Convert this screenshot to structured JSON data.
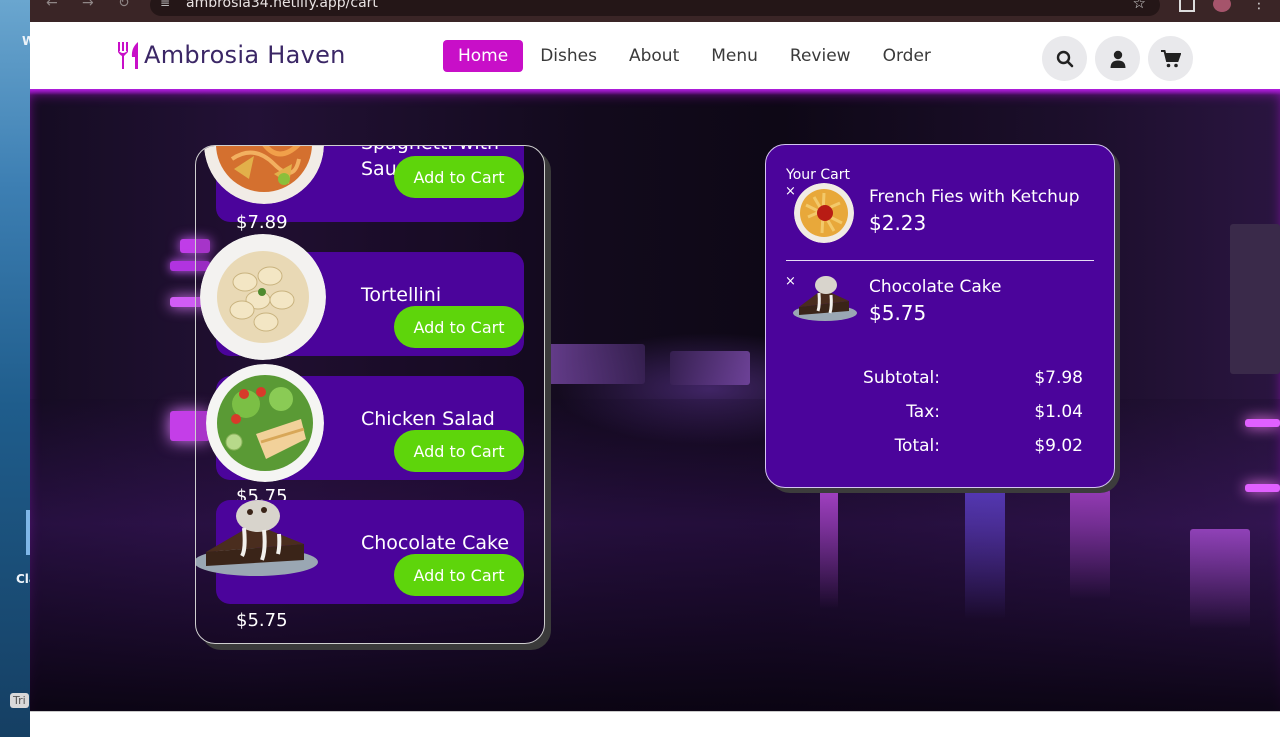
{
  "desktop": {
    "label_top": "W",
    "label_mid": "Cla",
    "badge": "Tri"
  },
  "browser": {
    "url": "ambrosia34.netlify.app/cart"
  },
  "site": {
    "logo_text": "Ambrosia Haven",
    "nav": [
      {
        "label": "Home",
        "active": true
      },
      {
        "label": "Dishes"
      },
      {
        "label": "About"
      },
      {
        "label": "Menu"
      },
      {
        "label": "Review"
      },
      {
        "label": "Order"
      }
    ],
    "icons": [
      "search-icon",
      "user-icon",
      "cart-icon"
    ],
    "accent": "#c80fc8",
    "card_color": "#4b049b",
    "button_color": "#5ed50b"
  },
  "dishes": [
    {
      "name": "Spaghetti with Sauce",
      "price": "$7.89",
      "button": "Add to Cart"
    },
    {
      "name": "Tortellini",
      "price": "",
      "button": "Add to Cart"
    },
    {
      "name": "Chicken Salad",
      "price": "$5.75",
      "button": "Add to Cart"
    },
    {
      "name": "Chocolate Cake",
      "price": "$5.75",
      "button": "Add to Cart"
    }
  ],
  "cart": {
    "title": "Your Cart",
    "remove_symbol": "×",
    "items": [
      {
        "name": "French Fies with Ketchup",
        "price": "$2.23"
      },
      {
        "name": "Chocolate Cake",
        "price": "$5.75"
      }
    ],
    "summary": [
      {
        "label": "Subtotal:",
        "value": "$7.98"
      },
      {
        "label": "Tax:",
        "value": "$1.04"
      },
      {
        "label": "Total:",
        "value": "$9.02"
      }
    ]
  }
}
